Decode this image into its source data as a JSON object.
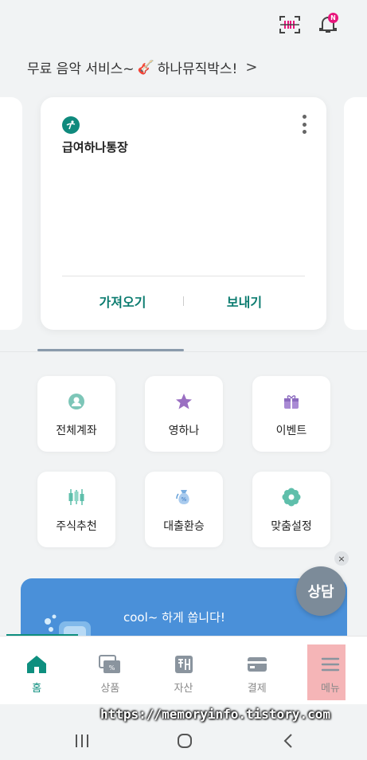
{
  "header": {
    "scan_icon": "barcode-scan-icon",
    "bell_icon": "bell-icon",
    "notification_badge": "N"
  },
  "promo": {
    "text_prefix": "무료 음악 서비스~",
    "emoji": "🎸",
    "text_suffix": "하나뮤직박스!",
    "chevron": ">"
  },
  "account_card": {
    "name": "급여하나통장",
    "actions": [
      "가져오기",
      "보내기"
    ]
  },
  "carousel": {
    "page": 1,
    "page_count": 2
  },
  "menu": [
    {
      "label": "전체계좌",
      "icon": "person-circle-icon",
      "color": "#7dc6b8"
    },
    {
      "label": "영하나",
      "icon": "star-icon",
      "color": "#9a6fc2"
    },
    {
      "label": "이벤트",
      "icon": "gift-icon",
      "color": "#9a6fc2"
    },
    {
      "label": "주식추천",
      "icon": "candlestick-icon",
      "color": "#5fbfab"
    },
    {
      "label": "대출환승",
      "icon": "money-bag-icon",
      "color": "#5a9ad6"
    },
    {
      "label": "맞춤설정",
      "icon": "flower-gear-icon",
      "color": "#5fbfab"
    }
  ],
  "banner": {
    "text": "cool~ 하게 쏩니다!"
  },
  "consult": {
    "label": "상담",
    "close": "×"
  },
  "bottom_nav": [
    {
      "label": "홈",
      "icon": "home-icon"
    },
    {
      "label": "상품",
      "icon": "product-card-icon"
    },
    {
      "label": "자산",
      "icon": "assets-icon"
    },
    {
      "label": "결제",
      "icon": "card-icon"
    },
    {
      "label": "메뉴",
      "icon": "hamburger-icon"
    }
  ],
  "watermark": "https://memoryinfo.tistory.com",
  "colors": {
    "brand": "#0e8f7f",
    "accent_pink": "#e8167c",
    "banner": "#4a90d9"
  }
}
